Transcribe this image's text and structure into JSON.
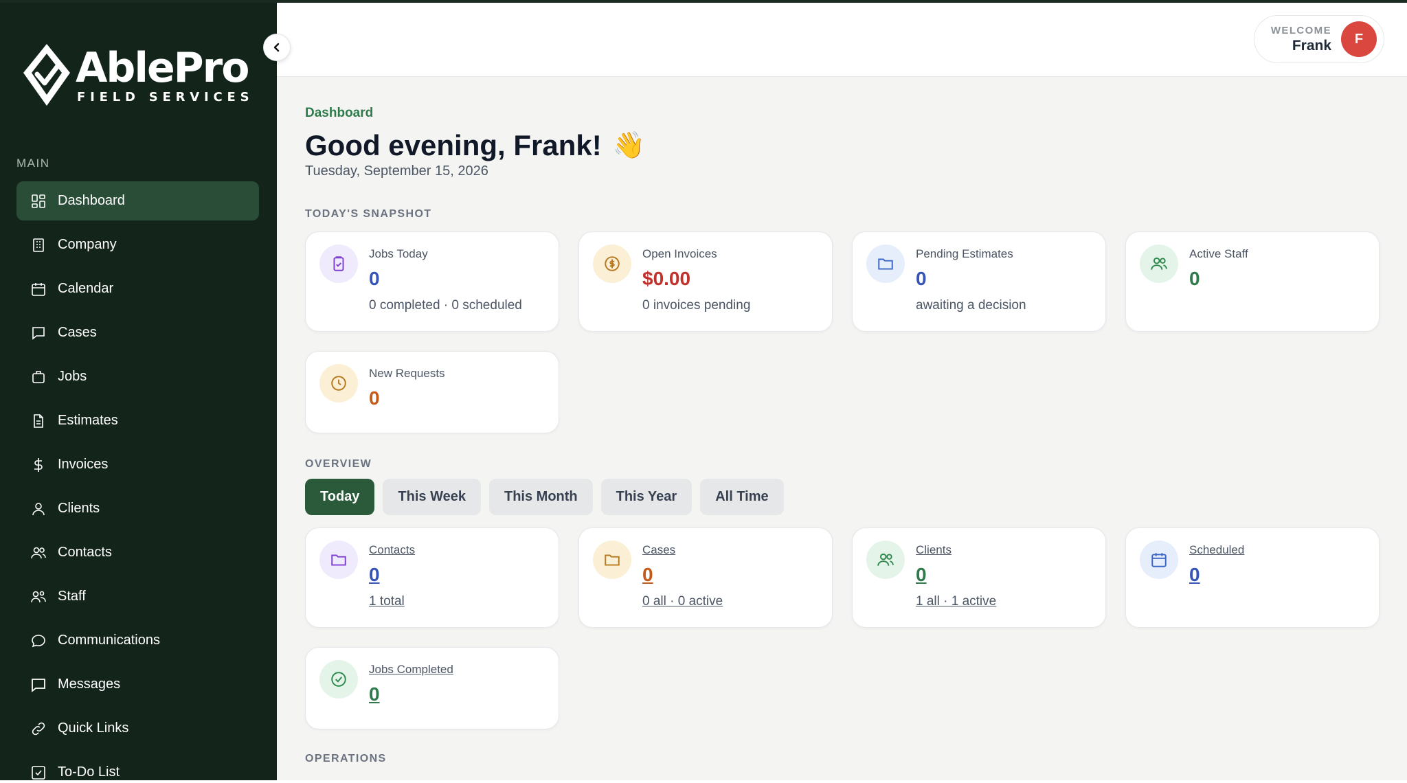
{
  "brand": {
    "name": "AblePro",
    "tagline": "FIELD SERVICES"
  },
  "sidebar": {
    "section": "MAIN",
    "items": [
      {
        "label": "Dashboard",
        "icon": "dashboard-icon"
      },
      {
        "label": "Company",
        "icon": "building-icon"
      },
      {
        "label": "Calendar",
        "icon": "calendar-icon"
      },
      {
        "label": "Cases",
        "icon": "chat-square-icon"
      },
      {
        "label": "Jobs",
        "icon": "briefcase-icon"
      },
      {
        "label": "Estimates",
        "icon": "document-icon"
      },
      {
        "label": "Invoices",
        "icon": "dollar-icon"
      },
      {
        "label": "Clients",
        "icon": "user-icon"
      },
      {
        "label": "Contacts",
        "icon": "users-icon"
      },
      {
        "label": "Staff",
        "icon": "staff-icon"
      },
      {
        "label": "Communications",
        "icon": "chat-bubble-icon"
      },
      {
        "label": "Messages",
        "icon": "message-icon"
      },
      {
        "label": "Quick Links",
        "icon": "link-icon"
      },
      {
        "label": "To-Do List",
        "icon": "checkbox-icon"
      }
    ]
  },
  "header": {
    "welcome_label": "WELCOME",
    "user_name": "Frank",
    "avatar_initial": "F"
  },
  "page": {
    "breadcrumb": "Dashboard",
    "greeting": "Good evening, Frank!",
    "wave": "👋",
    "date": "Tuesday, September 15, 2026"
  },
  "snapshot": {
    "title": "TODAY'S SNAPSHOT",
    "cards": [
      {
        "label": "Jobs Today",
        "value": "0",
        "sub": "0 completed · 0 scheduled",
        "icon": "clipboard-check-icon"
      },
      {
        "label": "Open Invoices",
        "value": "$0.00",
        "sub": "0 invoices pending",
        "icon": "dollar-circle-icon"
      },
      {
        "label": "Pending Estimates",
        "value": "0",
        "sub": "awaiting a decision",
        "icon": "folder-icon"
      },
      {
        "label": "Active Staff",
        "value": "0",
        "sub": "",
        "icon": "users-icon"
      },
      {
        "label": "New Requests",
        "value": "0",
        "sub": "",
        "icon": "clock-icon"
      }
    ]
  },
  "overview": {
    "title": "OVERVIEW",
    "tabs": [
      "Today",
      "This Week",
      "This Month",
      "This Year",
      "All Time"
    ],
    "active_tab": "Today",
    "cards": [
      {
        "label": "Contacts",
        "value": "0",
        "sub": "1 total",
        "icon": "folder-icon"
      },
      {
        "label": "Cases",
        "value": "0",
        "sub": "0 all · 0 active",
        "icon": "folder-icon"
      },
      {
        "label": "Clients",
        "value": "0",
        "sub": "1 all · 1 active",
        "icon": "users-icon"
      },
      {
        "label": "Scheduled",
        "value": "0",
        "sub": "",
        "icon": "calendar-icon"
      },
      {
        "label": "Jobs Completed",
        "value": "0",
        "sub": "",
        "icon": "check-circle-icon"
      }
    ]
  },
  "operations": {
    "title": "OPERATIONS"
  },
  "colors": {
    "sidebar": "#13251b",
    "accent": "#2a5a3a",
    "avatar": "#d9473f"
  }
}
